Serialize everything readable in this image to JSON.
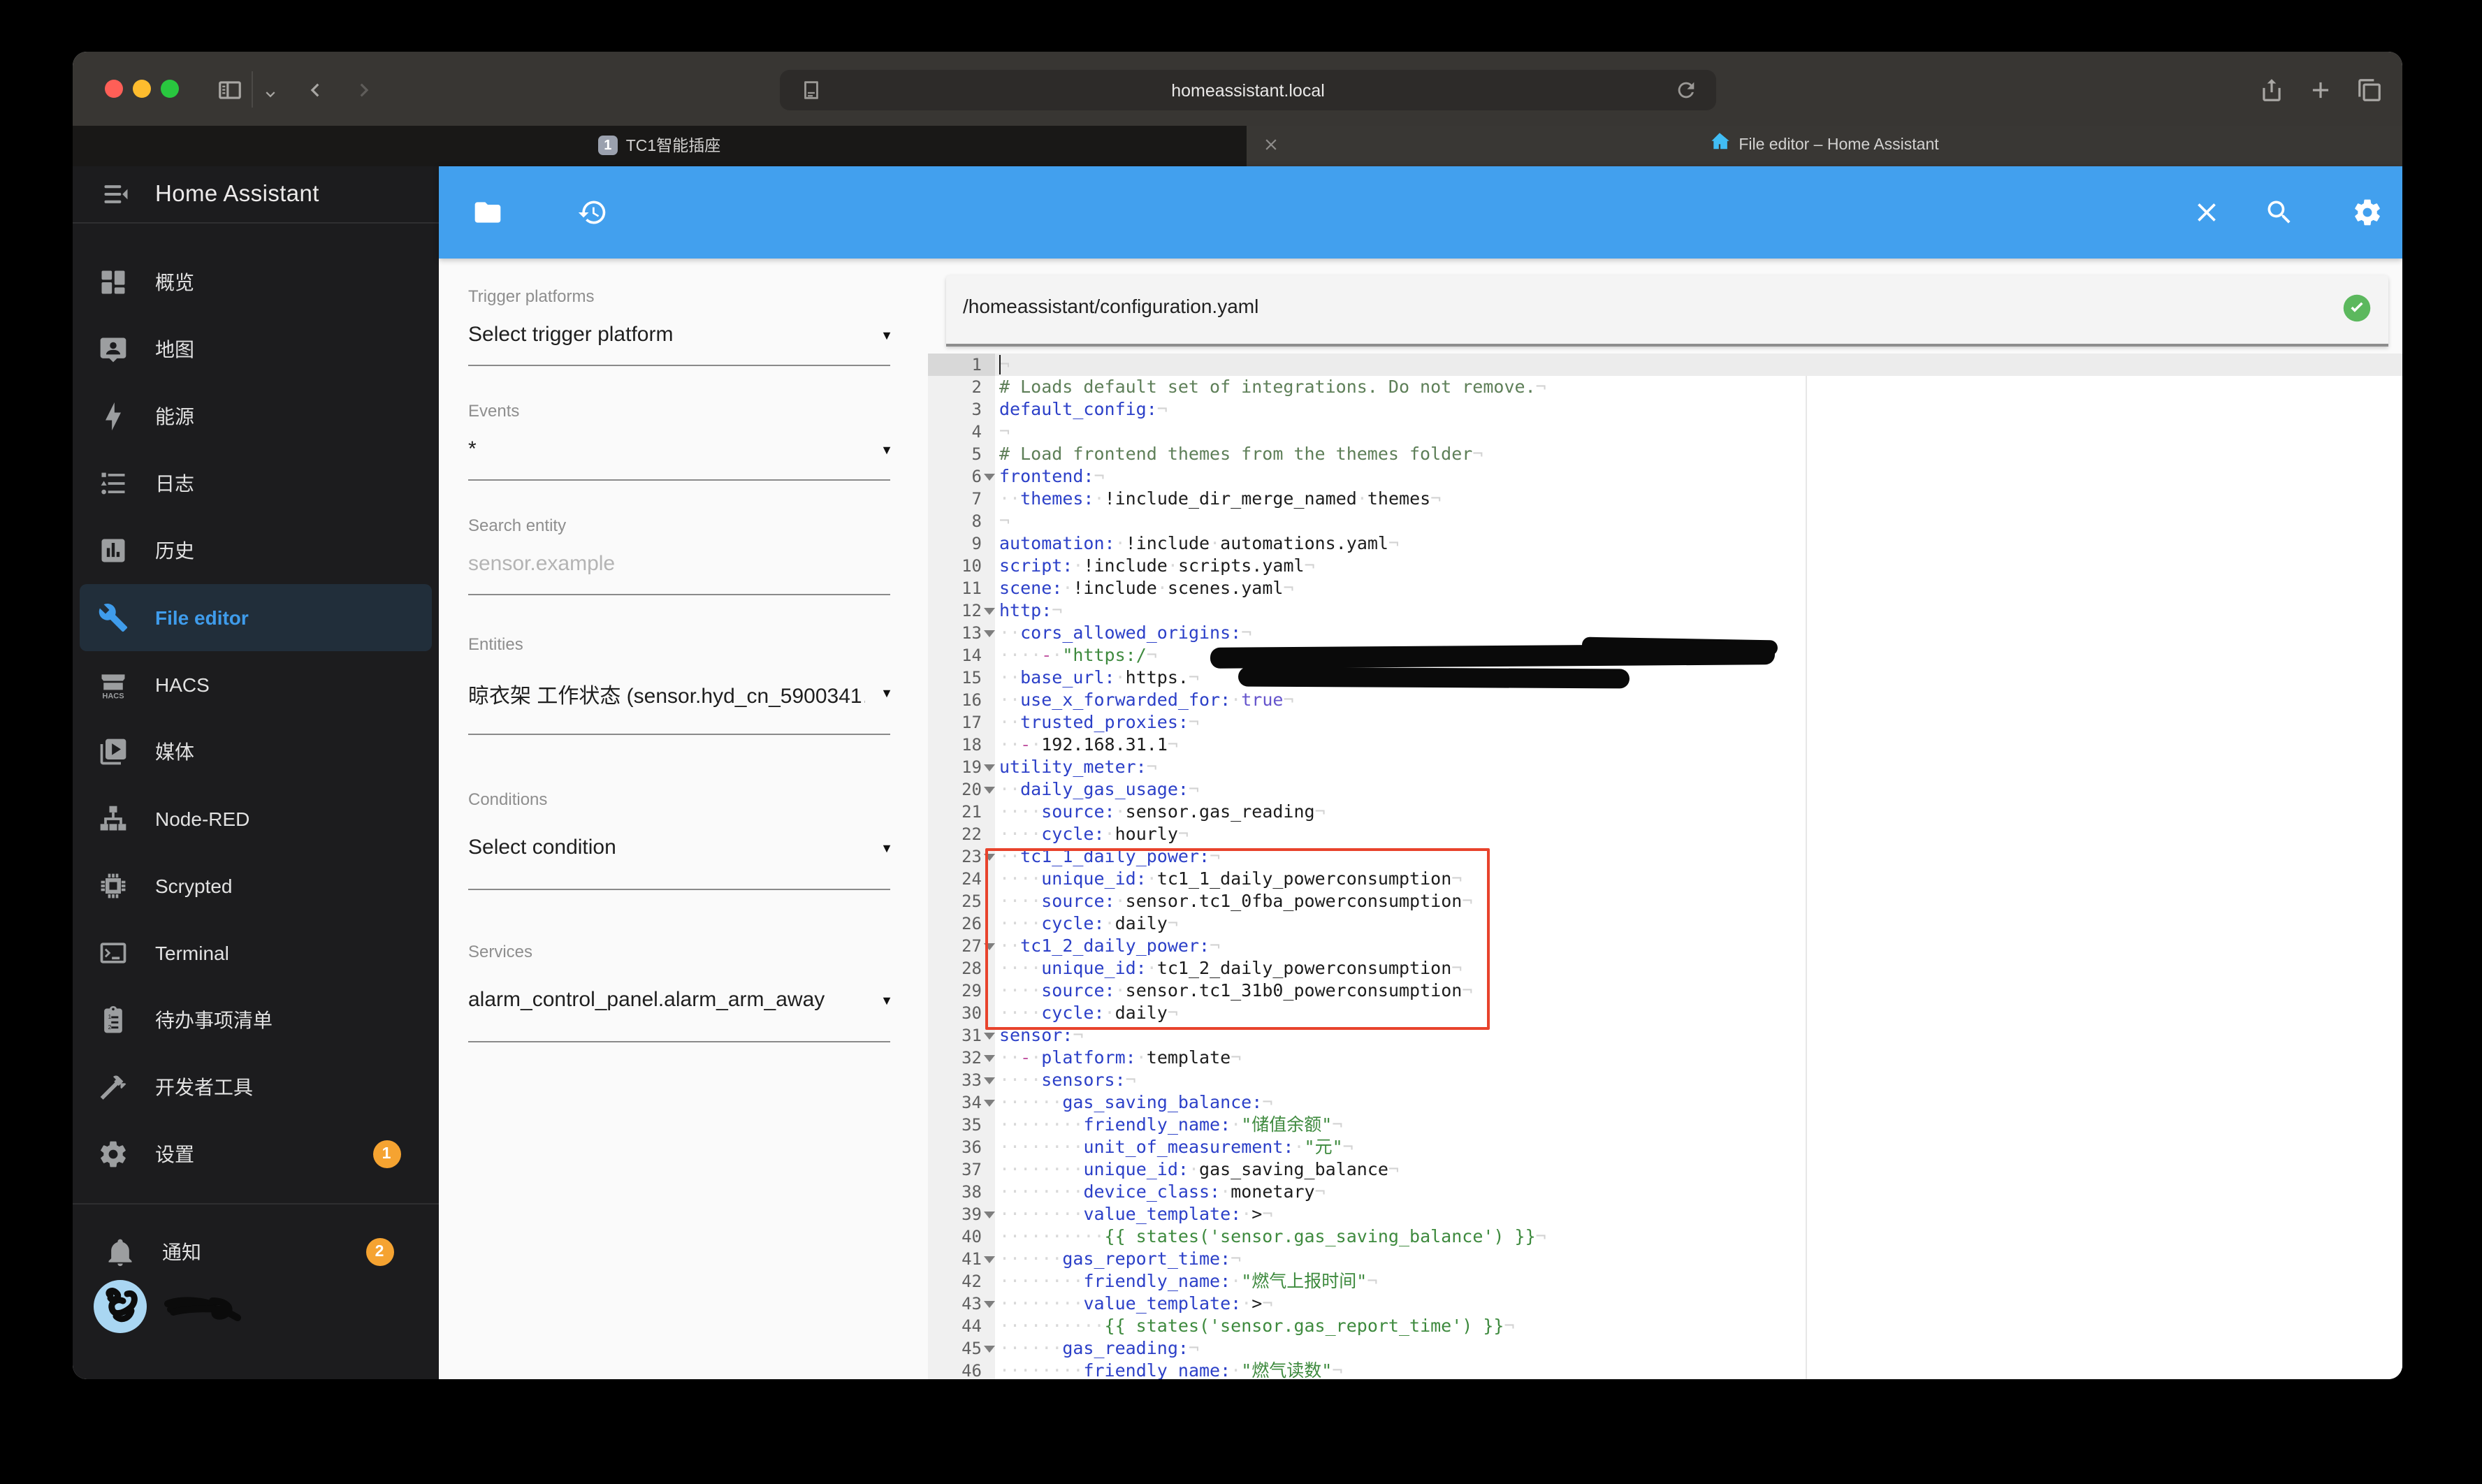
{
  "browser": {
    "url": "homeassistant.local",
    "tabs": [
      {
        "favicon_badge": "1",
        "title": "TC1智能插座"
      },
      {
        "title": "File editor – Home Assistant"
      }
    ]
  },
  "sidebar": {
    "title": "Home Assistant",
    "items": [
      {
        "id": "overview",
        "label": "概览",
        "icon": "view-dashboard-icon"
      },
      {
        "id": "map",
        "label": "地图",
        "icon": "account-bubble-icon"
      },
      {
        "id": "energy",
        "label": "能源",
        "icon": "lightning-bolt-icon"
      },
      {
        "id": "logbook",
        "label": "日志",
        "icon": "list-bulleted-icon"
      },
      {
        "id": "history",
        "label": "历史",
        "icon": "chart-box-icon"
      },
      {
        "id": "file-editor",
        "label": "File editor",
        "icon": "wrench-icon",
        "selected": true
      },
      {
        "id": "hacs",
        "label": "HACS",
        "icon": "hacs-store-icon"
      },
      {
        "id": "media",
        "label": "媒体",
        "icon": "play-box-icon"
      },
      {
        "id": "node-red",
        "label": "Node-RED",
        "icon": "sitemap-icon"
      },
      {
        "id": "scrypted",
        "label": "Scrypted",
        "icon": "chip-icon"
      },
      {
        "id": "terminal",
        "label": "Terminal",
        "icon": "console-icon"
      },
      {
        "id": "todo",
        "label": "待办事项清单",
        "icon": "clipboard-list-icon"
      },
      {
        "id": "dev-tools",
        "label": "开发者工具",
        "icon": "hammer-icon"
      },
      {
        "id": "settings",
        "label": "设置",
        "icon": "cog-icon",
        "badge": "1"
      }
    ],
    "notifications": {
      "label": "通知",
      "icon": "bell-icon",
      "badge": "2"
    }
  },
  "panel": {
    "fields": [
      {
        "label": "Trigger platforms",
        "value": "Select trigger platform",
        "kind": "select",
        "group": "a"
      },
      {
        "label": "Events",
        "value": "*",
        "kind": "select",
        "group": "a"
      },
      {
        "label": "Search entity",
        "placeholder": "sensor.example",
        "kind": "input",
        "group": "a"
      },
      {
        "label": "Entities",
        "value": "晾衣架 工作状态 (sensor.hyd_cn_5900341…",
        "kind": "select",
        "group": "b"
      },
      {
        "label": "Conditions",
        "value": "Select condition",
        "kind": "select",
        "group": "b"
      },
      {
        "label": "Services",
        "value": "alarm_control_panel.alarm_arm_away",
        "kind": "select",
        "group": "b"
      }
    ]
  },
  "editor": {
    "path": "/homeassistant/configuration.yaml",
    "active_line": 1,
    "invisibles": {
      "space": "·",
      "eol": "¬"
    },
    "highlight_box": {
      "from_line": 23,
      "to_line": 30
    },
    "fold_lines": [
      6,
      12,
      13,
      19,
      20,
      23,
      27,
      31,
      32,
      33,
      34,
      39,
      41,
      43,
      45
    ],
    "lines": [
      {
        "n": 1,
        "t": []
      },
      {
        "n": 2,
        "t": [
          [
            "cm",
            "# Loads default set of integrations. Do not remove."
          ]
        ]
      },
      {
        "n": 3,
        "t": [
          [
            "k",
            "default_config:"
          ]
        ]
      },
      {
        "n": 4,
        "t": []
      },
      {
        "n": 5,
        "t": [
          [
            "cm",
            "# Load frontend themes from the themes folder"
          ]
        ]
      },
      {
        "n": 6,
        "t": [
          [
            "k",
            "frontend:"
          ]
        ]
      },
      {
        "n": 7,
        "t": [
          [
            "ws",
            "··"
          ],
          [
            "k",
            "themes:"
          ],
          [
            "ws",
            "·"
          ],
          [
            "v",
            "!include_dir_merge_named"
          ],
          [
            "ws",
            "·"
          ],
          [
            "v",
            "themes"
          ]
        ]
      },
      {
        "n": 8,
        "t": []
      },
      {
        "n": 9,
        "t": [
          [
            "k",
            "automation:"
          ],
          [
            "ws",
            "·"
          ],
          [
            "v",
            "!include"
          ],
          [
            "ws",
            "·"
          ],
          [
            "v",
            "automations.yaml"
          ]
        ]
      },
      {
        "n": 10,
        "t": [
          [
            "k",
            "script:"
          ],
          [
            "ws",
            "·"
          ],
          [
            "v",
            "!include"
          ],
          [
            "ws",
            "·"
          ],
          [
            "v",
            "scripts.yaml"
          ]
        ]
      },
      {
        "n": 11,
        "t": [
          [
            "k",
            "scene:"
          ],
          [
            "ws",
            "·"
          ],
          [
            "v",
            "!include"
          ],
          [
            "ws",
            "·"
          ],
          [
            "v",
            "scenes.yaml"
          ]
        ]
      },
      {
        "n": 12,
        "t": [
          [
            "k",
            "http:"
          ]
        ]
      },
      {
        "n": 13,
        "t": [
          [
            "ws",
            "··"
          ],
          [
            "k",
            "cors_allowed_origins:"
          ]
        ]
      },
      {
        "n": 14,
        "t": [
          [
            "ws",
            "····"
          ],
          [
            "d",
            "-"
          ],
          [
            "ws",
            "·"
          ],
          [
            "s",
            "\"https:/"
          ]
        ]
      },
      {
        "n": 15,
        "t": [
          [
            "ws",
            "··"
          ],
          [
            "k",
            "base_url:"
          ],
          [
            "ws",
            "·"
          ],
          [
            "v",
            "https."
          ]
        ]
      },
      {
        "n": 16,
        "t": [
          [
            "ws",
            "··"
          ],
          [
            "k",
            "use_x_forwarded_for:"
          ],
          [
            "ws",
            "·"
          ],
          [
            "b",
            "true"
          ]
        ]
      },
      {
        "n": 17,
        "t": [
          [
            "ws",
            "··"
          ],
          [
            "k",
            "trusted_proxies:"
          ]
        ]
      },
      {
        "n": 18,
        "t": [
          [
            "ws",
            "··"
          ],
          [
            "d",
            "-"
          ],
          [
            "ws",
            "·"
          ],
          [
            "v",
            "192.168.31.1"
          ]
        ]
      },
      {
        "n": 19,
        "t": [
          [
            "k",
            "utility_meter:"
          ]
        ]
      },
      {
        "n": 20,
        "t": [
          [
            "ws",
            "··"
          ],
          [
            "k",
            "daily_gas_usage:"
          ]
        ]
      },
      {
        "n": 21,
        "t": [
          [
            "ws",
            "····"
          ],
          [
            "k",
            "source:"
          ],
          [
            "ws",
            "·"
          ],
          [
            "v",
            "sensor.gas_reading"
          ]
        ]
      },
      {
        "n": 22,
        "t": [
          [
            "ws",
            "····"
          ],
          [
            "k",
            "cycle:"
          ],
          [
            "ws",
            "·"
          ],
          [
            "v",
            "hourly"
          ]
        ]
      },
      {
        "n": 23,
        "t": [
          [
            "ws",
            "··"
          ],
          [
            "k",
            "tc1_1_daily_power:"
          ]
        ]
      },
      {
        "n": 24,
        "t": [
          [
            "ws",
            "····"
          ],
          [
            "k",
            "unique_id:"
          ],
          [
            "ws",
            "·"
          ],
          [
            "v",
            "tc1_1_daily_powerconsumption"
          ]
        ]
      },
      {
        "n": 25,
        "t": [
          [
            "ws",
            "····"
          ],
          [
            "k",
            "source:"
          ],
          [
            "ws",
            "·"
          ],
          [
            "v",
            "sensor.tc1_0fba_powerconsumption"
          ]
        ]
      },
      {
        "n": 26,
        "t": [
          [
            "ws",
            "····"
          ],
          [
            "k",
            "cycle:"
          ],
          [
            "ws",
            "·"
          ],
          [
            "v",
            "daily"
          ]
        ]
      },
      {
        "n": 27,
        "t": [
          [
            "ws",
            "··"
          ],
          [
            "k",
            "tc1_2_daily_power:"
          ]
        ]
      },
      {
        "n": 28,
        "t": [
          [
            "ws",
            "····"
          ],
          [
            "k",
            "unique_id:"
          ],
          [
            "ws",
            "·"
          ],
          [
            "v",
            "tc1_2_daily_powerconsumption"
          ]
        ]
      },
      {
        "n": 29,
        "t": [
          [
            "ws",
            "····"
          ],
          [
            "k",
            "source:"
          ],
          [
            "ws",
            "·"
          ],
          [
            "v",
            "sensor.tc1_31b0_powerconsumption"
          ]
        ]
      },
      {
        "n": 30,
        "t": [
          [
            "ws",
            "····"
          ],
          [
            "k",
            "cycle:"
          ],
          [
            "ws",
            "·"
          ],
          [
            "v",
            "daily"
          ]
        ]
      },
      {
        "n": 31,
        "t": [
          [
            "k",
            "sensor:"
          ]
        ]
      },
      {
        "n": 32,
        "t": [
          [
            "ws",
            "··"
          ],
          [
            "d",
            "-"
          ],
          [
            "ws",
            "·"
          ],
          [
            "k",
            "platform:"
          ],
          [
            "ws",
            "·"
          ],
          [
            "v",
            "template"
          ]
        ]
      },
      {
        "n": 33,
        "t": [
          [
            "ws",
            "····"
          ],
          [
            "k",
            "sensors:"
          ]
        ]
      },
      {
        "n": 34,
        "t": [
          [
            "ws",
            "······"
          ],
          [
            "k",
            "gas_saving_balance:"
          ]
        ]
      },
      {
        "n": 35,
        "t": [
          [
            "ws",
            "········"
          ],
          [
            "k",
            "friendly_name:"
          ],
          [
            "ws",
            "·"
          ],
          [
            "s",
            "\"储值余额\""
          ]
        ]
      },
      {
        "n": 36,
        "t": [
          [
            "ws",
            "········"
          ],
          [
            "k",
            "unit_of_measurement:"
          ],
          [
            "ws",
            "·"
          ],
          [
            "s",
            "\"元\""
          ]
        ]
      },
      {
        "n": 37,
        "t": [
          [
            "ws",
            "········"
          ],
          [
            "k",
            "unique_id:"
          ],
          [
            "ws",
            "·"
          ],
          [
            "v",
            "gas_saving_balance"
          ]
        ]
      },
      {
        "n": 38,
        "t": [
          [
            "ws",
            "········"
          ],
          [
            "k",
            "device_class:"
          ],
          [
            "ws",
            "·"
          ],
          [
            "v",
            "monetary"
          ]
        ]
      },
      {
        "n": 39,
        "t": [
          [
            "ws",
            "········"
          ],
          [
            "k",
            "value_template:"
          ],
          [
            "ws",
            "·"
          ],
          [
            "v",
            ">"
          ]
        ]
      },
      {
        "n": 40,
        "t": [
          [
            "ws",
            "··········"
          ],
          [
            "s",
            "{{ states('sensor.gas_saving_balance') }}"
          ]
        ]
      },
      {
        "n": 41,
        "t": [
          [
            "ws",
            "······"
          ],
          [
            "k",
            "gas_report_time:"
          ]
        ]
      },
      {
        "n": 42,
        "t": [
          [
            "ws",
            "········"
          ],
          [
            "k",
            "friendly_name:"
          ],
          [
            "ws",
            "·"
          ],
          [
            "s",
            "\"燃气上报时间\""
          ]
        ]
      },
      {
        "n": 43,
        "t": [
          [
            "ws",
            "········"
          ],
          [
            "k",
            "value_template:"
          ],
          [
            "ws",
            "·"
          ],
          [
            "v",
            ">"
          ]
        ]
      },
      {
        "n": 44,
        "t": [
          [
            "ws",
            "··········"
          ],
          [
            "s",
            "{{ states('sensor.gas_report_time') }}"
          ]
        ]
      },
      {
        "n": 45,
        "t": [
          [
            "ws",
            "······"
          ],
          [
            "k",
            "gas_reading:"
          ]
        ]
      },
      {
        "n": 46,
        "t": [
          [
            "ws",
            "········"
          ],
          [
            "k",
            "friendly_name:"
          ],
          [
            "ws",
            "·"
          ],
          [
            "s",
            "\"燃气读数\""
          ]
        ]
      }
    ]
  },
  "colors": {
    "toolbar_blue": "#42a0ee",
    "sidebar_selected": "#3f9ceb",
    "badge_orange": "#f5a331",
    "fab_red": "#ee584d",
    "check_green": "#5cb85e",
    "highlight_red": "#e8432c"
  }
}
